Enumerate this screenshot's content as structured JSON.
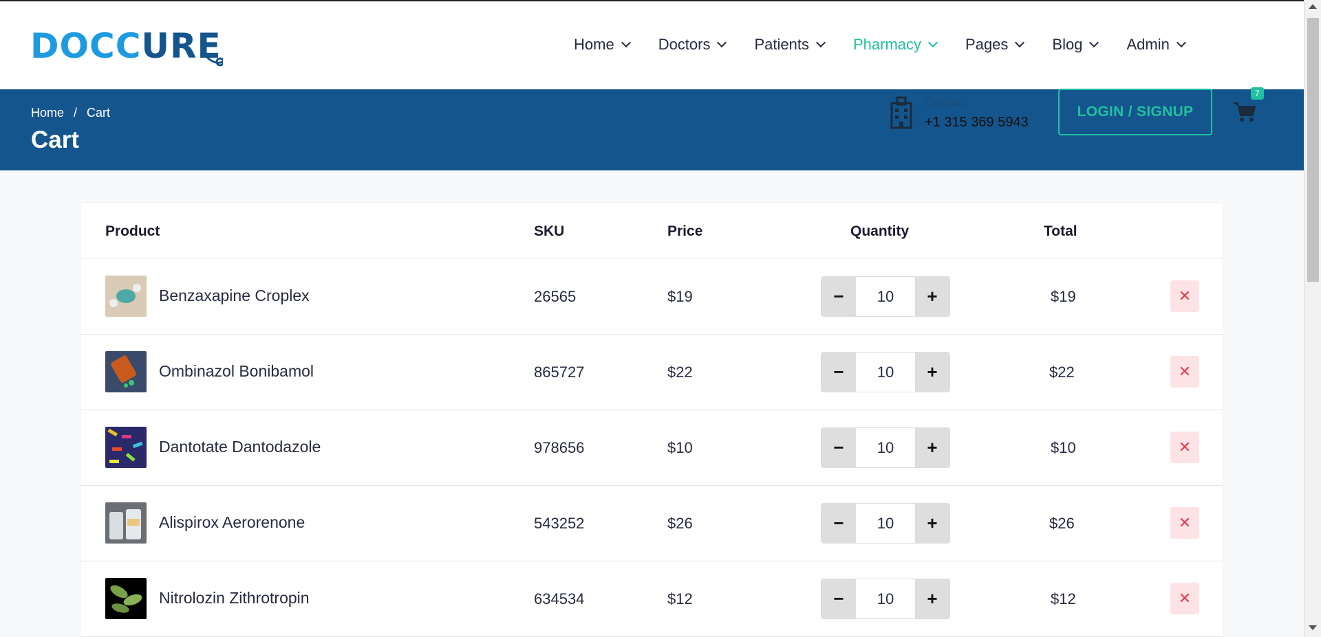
{
  "brand": {
    "logo_text_a": "DOCC",
    "logo_text_b": "URE"
  },
  "nav": [
    {
      "label": "Home",
      "active": false
    },
    {
      "label": "Doctors",
      "active": false
    },
    {
      "label": "Patients",
      "active": false
    },
    {
      "label": "Pharmacy",
      "active": true
    },
    {
      "label": "Pages",
      "active": false
    },
    {
      "label": "Blog",
      "active": false
    },
    {
      "label": "Admin",
      "active": false
    }
  ],
  "breadcrumb": {
    "home": "Home",
    "separator": "/",
    "current": "Cart"
  },
  "page_title": "Cart",
  "contact": {
    "label": "Contact",
    "phone": "+1 315 369 5943"
  },
  "login_label": "LOGIN / SIGNUP",
  "cart": {
    "count": "7"
  },
  "table": {
    "headers": {
      "product": "Product",
      "sku": "SKU",
      "price": "Price",
      "quantity": "Quantity",
      "total": "Total"
    },
    "rows": [
      {
        "name": "Benzaxapine Croplex",
        "sku": "26565",
        "price": "$19",
        "qty": "10",
        "total": "$19"
      },
      {
        "name": "Ombinazol Bonibamol",
        "sku": "865727",
        "price": "$22",
        "qty": "10",
        "total": "$22"
      },
      {
        "name": "Dantotate Dantodazole",
        "sku": "978656",
        "price": "$10",
        "qty": "10",
        "total": "$10"
      },
      {
        "name": "Alispirox Aerorenone",
        "sku": "543252",
        "price": "$26",
        "qty": "10",
        "total": "$26"
      },
      {
        "name": "Nitrolozin Zithrotropin",
        "sku": "634534",
        "price": "$12",
        "qty": "10",
        "total": "$12"
      }
    ],
    "minus_label": "−",
    "plus_label": "+",
    "remove_label": "✕"
  },
  "colors": {
    "primary": "#15558d",
    "accent": "#20c0a0",
    "danger": "#e63c4c"
  }
}
